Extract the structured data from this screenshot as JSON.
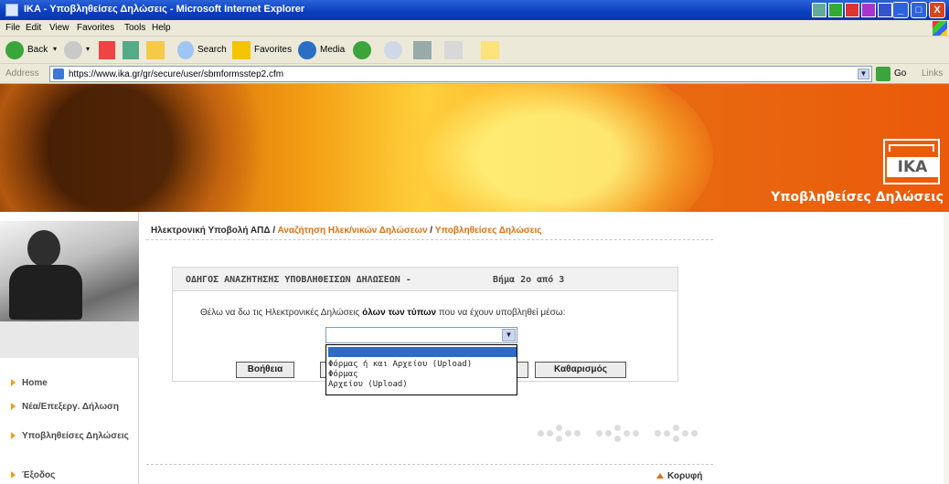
{
  "window": {
    "title": "IKA - Υποβληθείσες Δηλώσεις - Microsoft Internet Explorer",
    "win_buttons": [
      "_",
      "□",
      "X"
    ]
  },
  "menu": {
    "items": [
      "File",
      "Edit",
      "View",
      "Favorites",
      "Tools",
      "Help"
    ]
  },
  "toolbar": {
    "back": "Back",
    "search": "Search",
    "favorites": "Favorites",
    "media": "Media"
  },
  "address": {
    "label": "Address",
    "url": "https://www.ika.gr/gr/secure/user/sbmformsstep2.cfm",
    "go": "Go",
    "links": "Links"
  },
  "banner": {
    "logo": "IKA",
    "title": "Υποβληθείσες Δηλώσεις"
  },
  "sidebar": {
    "items": [
      {
        "label": "Home"
      },
      {
        "label": "Νέα/Επεξεργ. Δήλωση"
      },
      {
        "label": "Υποβληθείσες Δηλώσεις"
      },
      {
        "label": "Έξοδος"
      }
    ]
  },
  "breadcrumb": {
    "root": "Ηλεκτρονική Υποβολή ΑΠΔ",
    "sep": " / ",
    "link1": "Αναζήτηση Ηλεκ/νικών Δηλώσεων",
    "link2": "Υποβληθείσες Δηλώσεις"
  },
  "wizard": {
    "title": "ΟΔΗΓΟΣ ΑΝΑΖΗΤΗΣΗΣ ΥΠΟΒΛΗΘΕΙΣΩΝ ΔΗΛΩΣΕΩΝ -",
    "step": "Βήμα 2ο από 3",
    "text_before": "Θέλω να δω τις Ηλεκτρονικές Δηλώσεις",
    "text_bold": "όλων των τύπων",
    "text_after": "που να έχουν υποβληθεί μέσω:",
    "select_value": "",
    "options": [
      "",
      "Φόρμας ή και Αρχείου (Upload)",
      "Φόρμας",
      "Αρχείου (Upload)"
    ],
    "buttons": {
      "help": "Βοήθεια",
      "clear": "Καθαρισμός"
    }
  },
  "footer": {
    "top_link": "Κορυφή"
  }
}
